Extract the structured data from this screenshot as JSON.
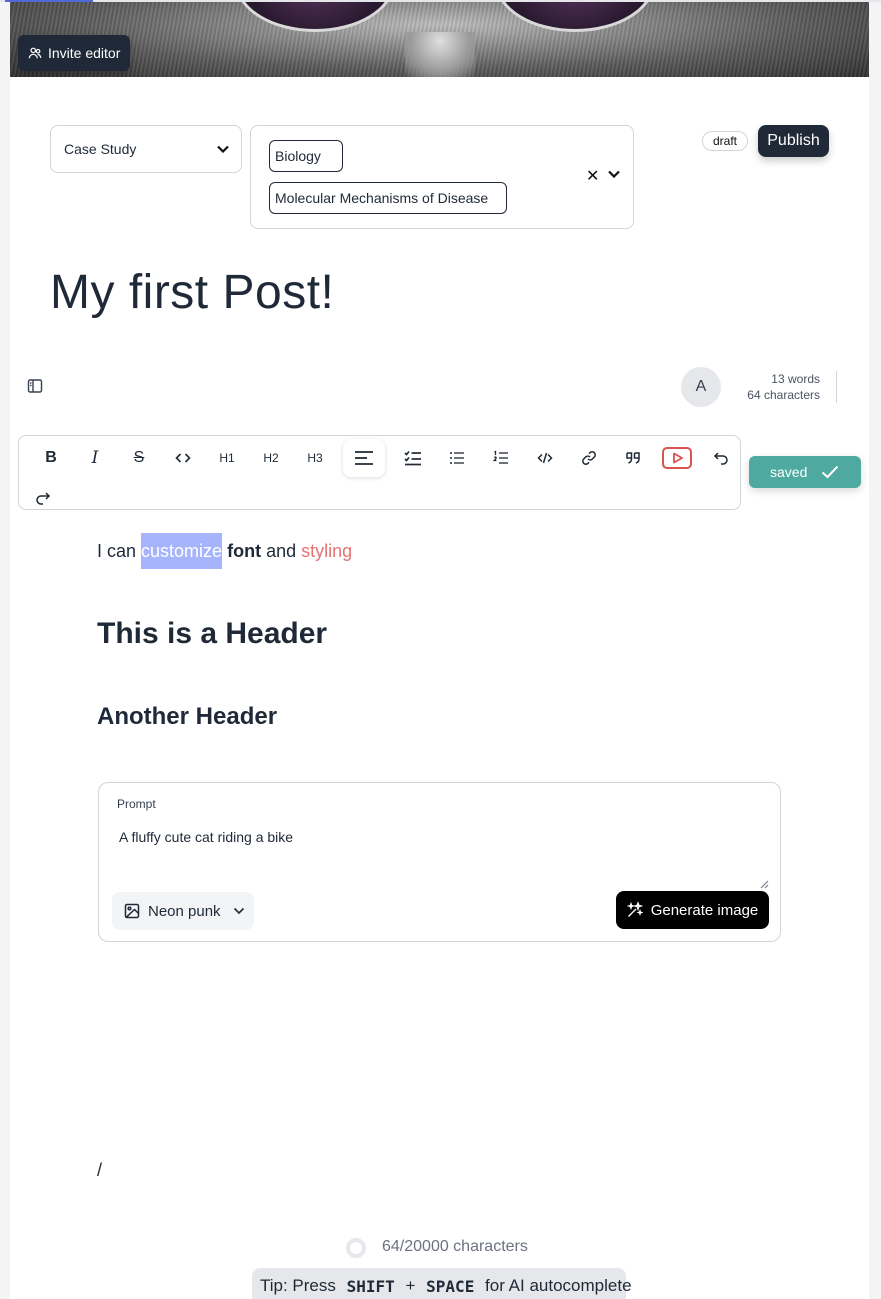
{
  "header": {
    "invite_label": "Invite editor"
  },
  "meta": {
    "post_type": "Case Study",
    "tags": [
      "Biology",
      "Molecular Mechanisms of Disease"
    ],
    "status_badge": "draft",
    "publish_label": "Publish"
  },
  "post": {
    "title": "My first Post!"
  },
  "editor": {
    "avatar_initial": "A",
    "word_count": "13 words",
    "char_count": "64 characters",
    "saved_label": "saved",
    "toolbar": {
      "bold": "B",
      "italic": "I",
      "strike": "S",
      "h1": "H1",
      "h2": "H2",
      "h3": "H3"
    }
  },
  "content": {
    "line1": {
      "part1": "I can ",
      "highlight": "customize",
      "part2": " ",
      "bold": "font",
      "part3": " and ",
      "styled": "styling"
    },
    "heading1": "This is a Header",
    "heading2": "Another Header",
    "prompt": {
      "label": "Prompt",
      "text": "A fluffy cute cat riding a bike",
      "style_value": "Neon punk",
      "generate_label": "Generate image"
    },
    "slash": "/"
  },
  "footer": {
    "char_counter": "64/20000 characters",
    "tip_prefix": "Tip: Press ",
    "tip_key1": "SHIFT",
    "tip_plus": " + ",
    "tip_key2": "SPACE",
    "tip_suffix": " for AI autocomplete"
  },
  "colors": {
    "accent_saved": "#4eaaa0",
    "dark_button": "#1f2937",
    "highlight": "#a5b4fc",
    "styled_text": "#e57373"
  }
}
